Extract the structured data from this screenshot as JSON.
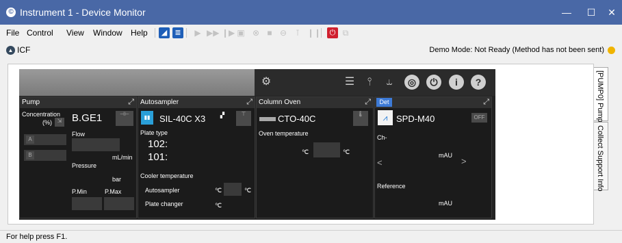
{
  "window": {
    "title": "Instrument 1 - Device Monitor",
    "minimize": "—",
    "maximize": "☐",
    "close": "✕"
  },
  "menu": {
    "items": [
      "File",
      "Control",
      "View",
      "Window",
      "Help"
    ]
  },
  "icf": {
    "label": "ICF",
    "demo_status": "Demo Mode: Not Ready (Method has not been sent)"
  },
  "side_tabs": [
    "[PUMP0] Pump",
    "Collect Support Info"
  ],
  "status_bar": "For help press F1.",
  "pump": {
    "title": "Pump",
    "concentration_label": "Concentration",
    "percent_label": "(%)",
    "model": "B.GE1",
    "ch_a": "A",
    "ch_b": "B",
    "flow_label": "Flow",
    "flow_unit": "mL/min",
    "pressure_label": "Pressure",
    "pressure_unit": "bar",
    "pmin_label": "P.Min",
    "pmax_label": "P.Max"
  },
  "autosampler": {
    "title": "Autosampler",
    "model": "SIL-40C X3",
    "plate_type_label": "Plate type",
    "plate_102": "102:",
    "plate_101": "101:",
    "cooler_label": "Cooler temperature",
    "autosampler_label": "Autosampler",
    "plate_changer_label": "Plate changer",
    "unit_c": "℃"
  },
  "column_oven": {
    "title": "Column Oven",
    "model": "CTO-40C",
    "oven_temp_label": "Oven temperature",
    "unit_c": "℃"
  },
  "detector": {
    "tab": "Det",
    "model": "SPD-M40",
    "off_label": "OFF",
    "ch_label": "Ch-",
    "unit": "mAU",
    "reference_label": "Reference",
    "prev": "<",
    "next": ">"
  }
}
